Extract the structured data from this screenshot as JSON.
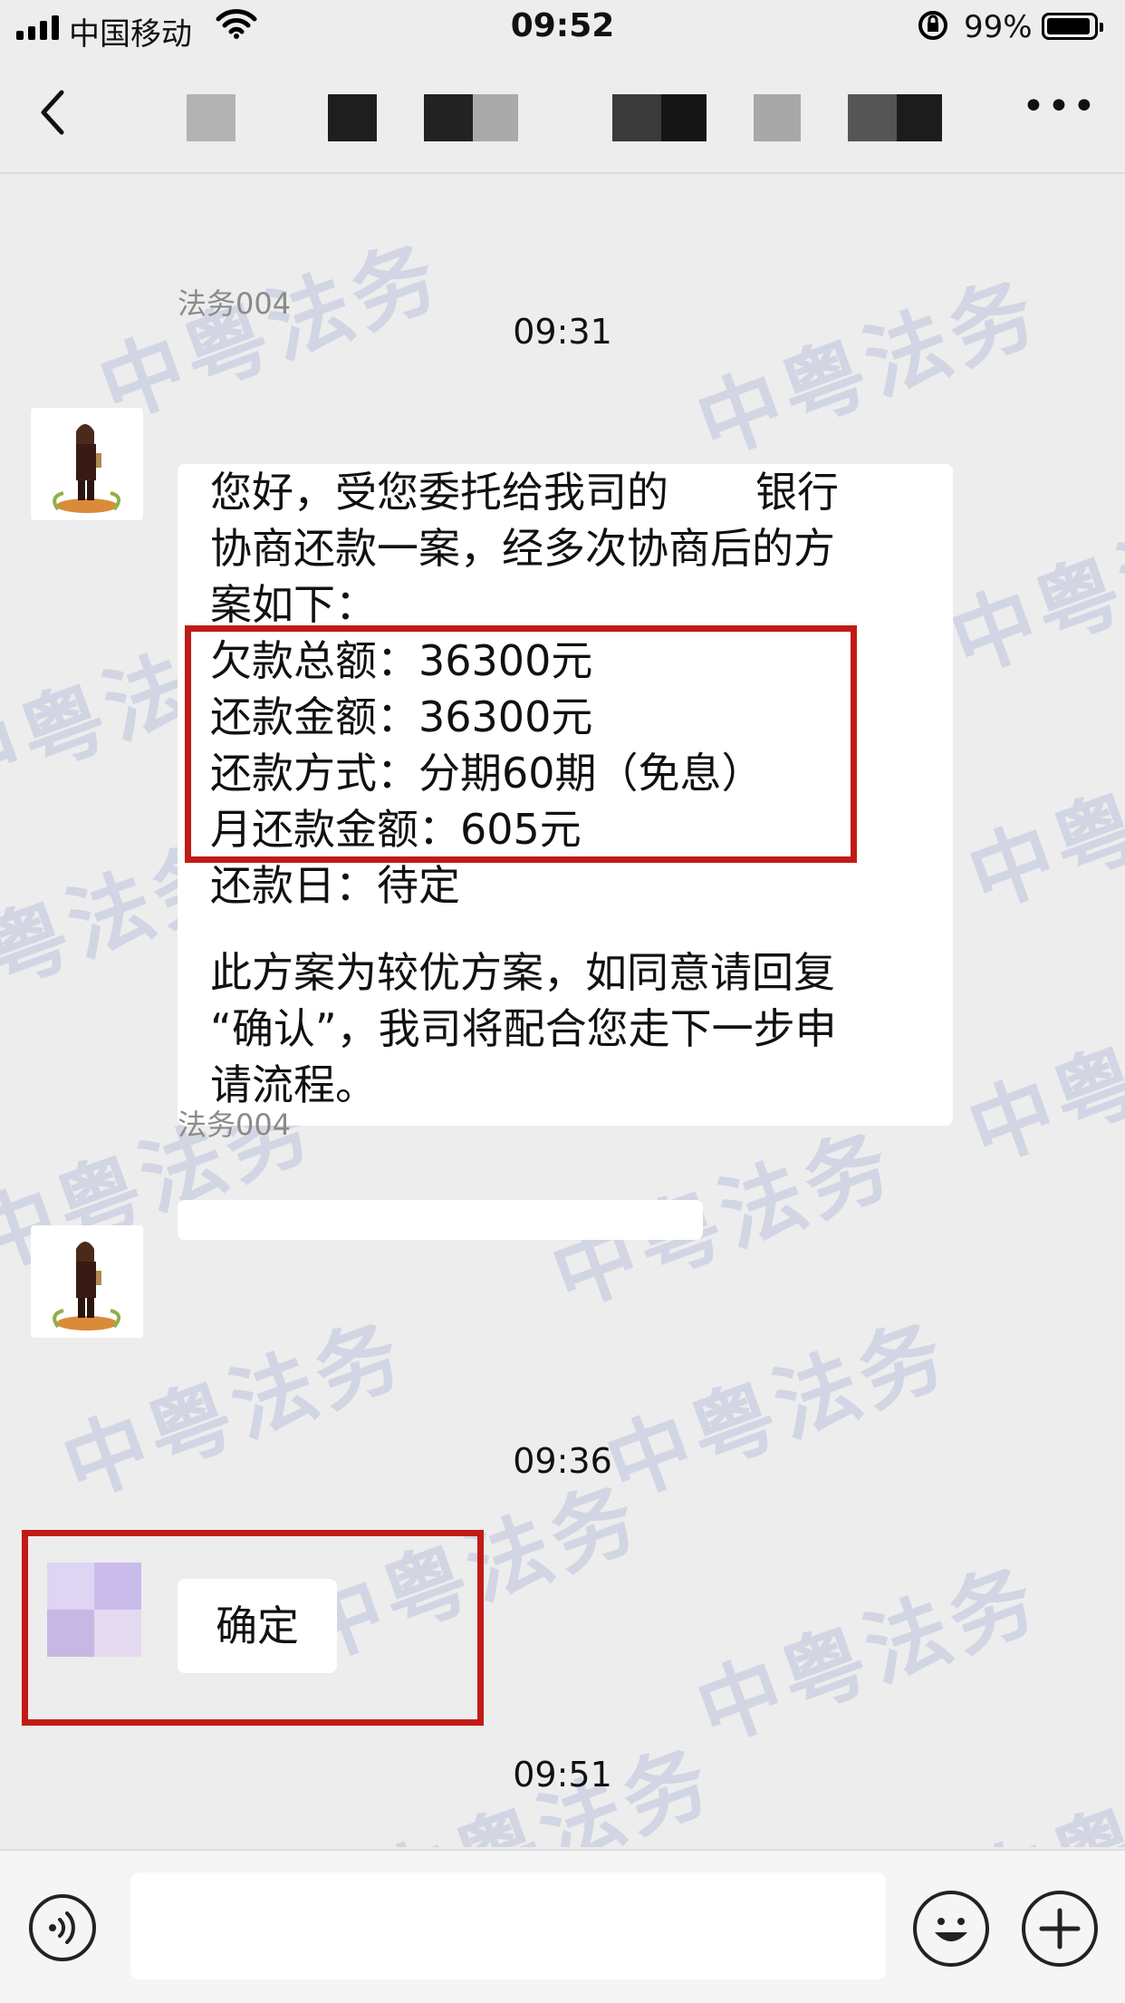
{
  "status_bar": {
    "carrier": "中国移动",
    "time": "09:52",
    "battery_percent": "99%"
  },
  "nav": {
    "back_icon": "chevron-left-icon",
    "more_icon": "more-dots-icon",
    "more_label": "•••"
  },
  "watermark": "中粤法务",
  "messages": {
    "ts1": "09:31",
    "sender1": "法务004",
    "bubble1_lines": [
      "您好，受您委托给我司的",
      "银行",
      "协商还款一案，经多次协商后的方",
      "案如下：",
      "欠款总额：36300元",
      "还款金额：36300元",
      "还款方式：分期60期（免息）",
      "月还款金额：605元",
      "还款日：待定",
      "此方案为较优方案，如同意请回复",
      "“确认”，我司将配合您走下一步申",
      "请流程。"
    ],
    "sender2": "法务004",
    "ts2": "09:36",
    "self_text": "确定",
    "ts3": "09:51"
  },
  "input_bar": {
    "voice_icon": "voice-icon",
    "emoji_icon": "emoji-icon",
    "plus_icon": "plus-icon",
    "placeholder": ""
  },
  "colors": {
    "background": "#ededed",
    "highlight_red": "#c11b17",
    "watermark": "#8c96c8"
  }
}
